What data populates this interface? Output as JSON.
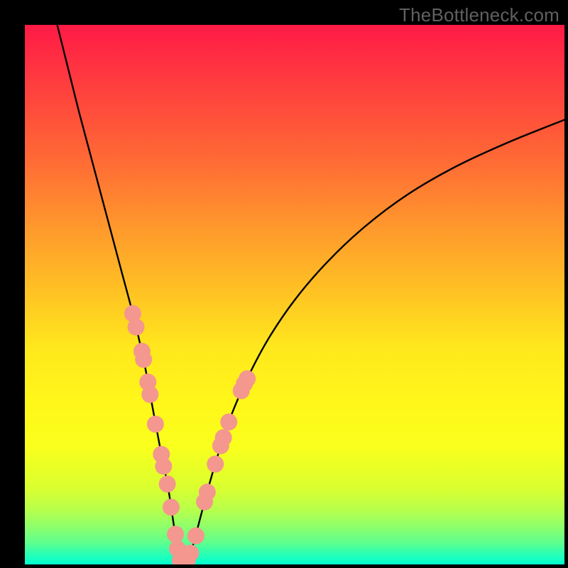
{
  "watermark": "TheBottleneck.com",
  "chart_data": {
    "type": "line",
    "title": "",
    "xlabel": "",
    "ylabel": "",
    "xlim": [
      0,
      100
    ],
    "ylim": [
      0,
      100
    ],
    "background_gradient": {
      "top": "#ff1a46",
      "middle": "#fff71a",
      "bottom": "#00ffd0",
      "meaning": "bottleneck severity (red=high, green=none)"
    },
    "series": [
      {
        "name": "bottleneck-curve",
        "stroke": "#000000",
        "stroke_width": 2,
        "x": [
          6,
          8,
          10,
          12,
          14,
          16,
          18,
          20,
          22,
          23.5,
          25,
          26.5,
          27.5,
          28.2,
          29,
          30,
          31.2,
          32.5,
          34,
          36,
          38,
          41,
          45,
          50,
          56,
          63,
          71,
          80,
          90,
          100
        ],
        "y": [
          100,
          92,
          84,
          76.5,
          69,
          61.5,
          54,
          46.5,
          38,
          30,
          22,
          14.5,
          8,
          3.5,
          0.4,
          0.6,
          3.7,
          8.6,
          14.2,
          21,
          27,
          34,
          41.6,
          49,
          56,
          62.6,
          68.6,
          73.8,
          78.4,
          82.4
        ]
      }
    ],
    "markers": {
      "name": "highlight-points",
      "color": "#F4978E",
      "radius": 12,
      "points": [
        {
          "x": 20.0,
          "y": 46.5
        },
        {
          "x": 20.6,
          "y": 44.0
        },
        {
          "x": 21.7,
          "y": 39.5
        },
        {
          "x": 22.0,
          "y": 38.0
        },
        {
          "x": 22.8,
          "y": 33.8
        },
        {
          "x": 23.2,
          "y": 31.5
        },
        {
          "x": 24.2,
          "y": 26.0
        },
        {
          "x": 25.3,
          "y": 20.4
        },
        {
          "x": 25.7,
          "y": 18.2
        },
        {
          "x": 26.4,
          "y": 14.9
        },
        {
          "x": 27.1,
          "y": 10.6
        },
        {
          "x": 27.9,
          "y": 5.6
        },
        {
          "x": 28.3,
          "y": 2.9
        },
        {
          "x": 28.8,
          "y": 0.7
        },
        {
          "x": 29.4,
          "y": 0.4
        },
        {
          "x": 30.1,
          "y": 0.8
        },
        {
          "x": 30.7,
          "y": 2.1
        },
        {
          "x": 31.7,
          "y": 5.3
        },
        {
          "x": 33.3,
          "y": 11.6
        },
        {
          "x": 33.8,
          "y": 13.4
        },
        {
          "x": 35.3,
          "y": 18.6
        },
        {
          "x": 36.3,
          "y": 22.0
        },
        {
          "x": 36.8,
          "y": 23.5
        },
        {
          "x": 37.8,
          "y": 26.4
        },
        {
          "x": 40.1,
          "y": 32.2
        },
        {
          "x": 40.7,
          "y": 33.5
        },
        {
          "x": 41.2,
          "y": 34.4
        }
      ]
    }
  }
}
